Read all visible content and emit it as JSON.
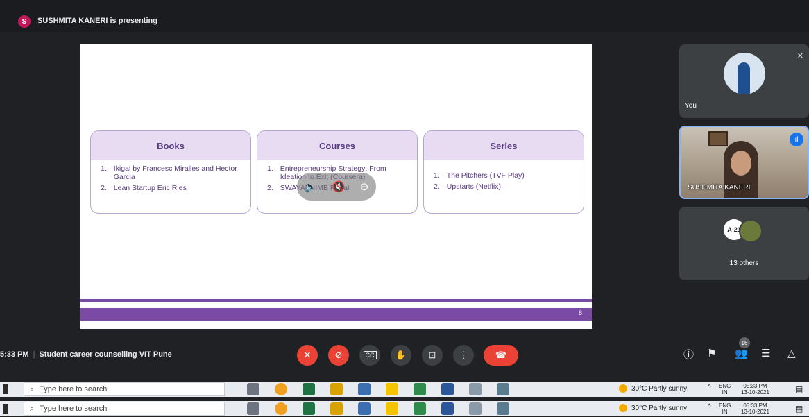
{
  "presenter": {
    "initial": "S",
    "text": "SUSHMITA KANERI is presenting"
  },
  "slide": {
    "cards": [
      {
        "title": "Books",
        "items": [
          {
            "n": "1.",
            "t": "Ikigai by Francesc Miralles and Hector Garcia"
          },
          {
            "n": "2.",
            "t": "Lean Startup Eric Ries"
          }
        ]
      },
      {
        "title": "Courses",
        "items": [
          {
            "n": "1.",
            "t": "Entrepreneurship Strategy: From Ideation to Exit (Coursera)"
          },
          {
            "n": "2.",
            "t": "SWAYAM IIMB Portal"
          }
        ]
      },
      {
        "title": "Series",
        "items": [
          {
            "n": "1.",
            "t": "The Pitchers (TVF Play)"
          },
          {
            "n": "2.",
            "t": "Upstarts (Netflix);"
          }
        ]
      }
    ],
    "page_number": "8"
  },
  "participants": {
    "you_label": "You",
    "presenter_name": "SUSHMITA KANERI",
    "others_avatar_text": "A-21",
    "others_label": "13 others",
    "count_badge": "16"
  },
  "meeting": {
    "time": "5:33 PM",
    "separator": "|",
    "name": "Student career counselling VIT Pune"
  },
  "taskbar": {
    "search_placeholder": "Type here to search",
    "weather": "30°C  Partly sunny",
    "lang_top": "ENG",
    "lang_bottom": "IN",
    "time": "05:33 PM",
    "date": "13-10-2021"
  },
  "colors": {
    "accent": "#7b4aa4",
    "hangup": "#ea4335",
    "speaking": "#1a73e8"
  }
}
